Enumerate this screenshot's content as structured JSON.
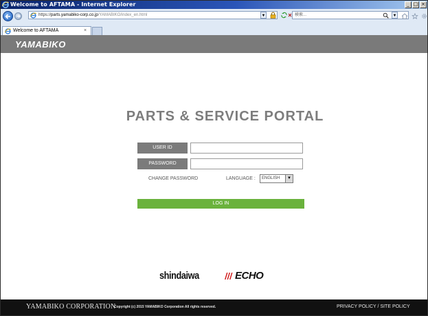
{
  "window": {
    "title": "Welcome to AFTAMA - Internet Explorer",
    "controls": [
      "_",
      "□",
      "×"
    ]
  },
  "addressbar": {
    "url_prefix": "https://",
    "url_host": "parts.yamabiko-corp.co.jp",
    "url_path": "/YAMABIKO/index_en.html",
    "search_placeholder": "検索..."
  },
  "tab": {
    "label": "Welcome to AFTAMA",
    "close": "×"
  },
  "header": {
    "logo": "YAMABIKO"
  },
  "main": {
    "title": "PARTS & SERVICE PORTAL",
    "user_id_label": "USER ID",
    "password_label": "PASSWORD",
    "change_password_link": "CHANGE PASSWORD",
    "language_label": "LANGUAGE :",
    "language_value": "ENGLISH",
    "language_arrow": "▼",
    "login_label": "LOG IN"
  },
  "brands": {
    "shindaiwa": "shindaiwa",
    "echo": "ECHO"
  },
  "footer": {
    "corporation": "YAMABIKO CORPORATION",
    "copyright": "Copyright (c) 2015 YAMABIKO Corporation All rights reserved.",
    "privacy": "PRIVACY POLICY",
    "separator": " / ",
    "site_policy": "SITE POLICY"
  },
  "colors": {
    "title_bar": "#0a246a",
    "header_bg": "#7a7a7a",
    "label_bg": "#7b7b7b",
    "login_green": "#6ab23c",
    "footer_bg": "#111111"
  },
  "icons": [
    "ie-icon",
    "back-arrow-icon",
    "forward-arrow-icon",
    "lock-icon",
    "refresh-icon",
    "stop-icon",
    "search-icon",
    "home-icon",
    "star-icon",
    "gear-icon"
  ]
}
